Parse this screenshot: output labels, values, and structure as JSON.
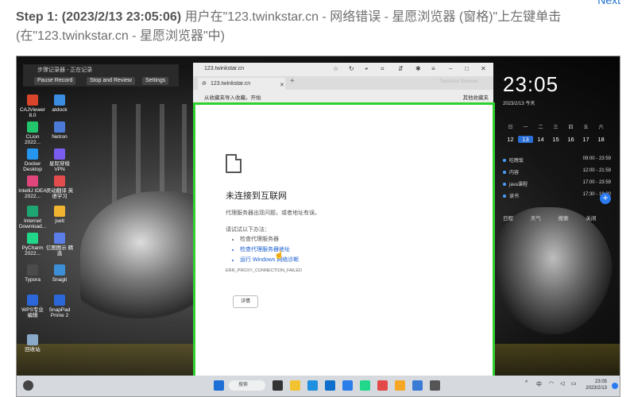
{
  "header": {
    "next_label": "Next",
    "step_label": "Step 1: (2023/2/13 23:05:06)",
    "step_desc": " 用户在\"123.twinkstar.cn - 网络错误  - 星愿浏览器 (窗格)\"上左键单击(在\"123.twinkstar.cn - 星愿浏览器\"中)"
  },
  "recorder": {
    "title": "步骤记录器 - 正在记录",
    "pause": "Pause Record",
    "stop": "Stop and Review",
    "settings": "Settings"
  },
  "desktop_icons": [
    {
      "label": "CAJViewer 8.0",
      "color": "#d9442b"
    },
    {
      "label": "atdock",
      "color": "#3a8de0"
    },
    {
      "label": "CLion 2022...",
      "color": "#22c56b"
    },
    {
      "label": "Netron",
      "color": "#4b7bd6"
    },
    {
      "label": "Docker Desktop",
      "color": "#2496ed"
    },
    {
      "label": "星际穿梭VPN",
      "color": "#7a5cf0"
    },
    {
      "label": "IntelliJ IDEA 2022...",
      "color": "#e0467c"
    },
    {
      "label": "灵动翻译 英语学习",
      "color": "#e24c4c"
    },
    {
      "label": "Internet Download...",
      "color": "#1ea672"
    },
    {
      "label": "jsetl",
      "color": "#f0b430"
    },
    {
      "label": "PyCharm 2022...",
      "color": "#21d789"
    },
    {
      "label": "亿图图示 精选",
      "color": "#5b7de8"
    },
    {
      "label": "Typora",
      "color": "#4b4b4b"
    },
    {
      "label": "Snagit",
      "color": "#3c8fd6"
    },
    {
      "label": "WPS专业 编辑",
      "color": "#2b67d8"
    },
    {
      "label": "SnapPad Prime 2",
      "color": "#2b67d8"
    },
    {
      "label": "回收站",
      "color": "#8aa8c8"
    }
  ],
  "browser": {
    "address": "123.twinkstar.cn",
    "tab_title": "123.twinkstar.cn",
    "tab_right": "Twinkstar Browser",
    "favorites_left": "从收藏夹导入收藏。开始",
    "favorites_right": "其他收藏夹"
  },
  "error_page": {
    "title": "未连接到互联网",
    "subtitle": "代理服务器出现问题，或者地址有误。",
    "try_label": "请试试以下办法：",
    "items": [
      "检查代理服务器",
      "检查代理服务器地址",
      "运行 Windows 网络诊断"
    ],
    "code": "ERR_PROXY_CONNECTION_FAILED",
    "details_button": "详情"
  },
  "widget": {
    "time": "23:05",
    "date": "2023/2/13  今天",
    "weekdays": [
      "日",
      "一",
      "二",
      "三",
      "四",
      "五",
      "六"
    ],
    "days": [
      "12",
      "13",
      "14",
      "15",
      "16",
      "17",
      "18"
    ],
    "selected_day": "13",
    "events": [
      {
        "label": "吃晚饭",
        "time": "09:00 - 23:59"
      },
      {
        "label": "内容",
        "time": "12:00 - 21:59"
      },
      {
        "label": "java课程",
        "time": "17:00 - 23:59"
      },
      {
        "label": "读书",
        "time": "17:30 - 18:30"
      }
    ],
    "footer": [
      "日程",
      "天气",
      "搜索",
      "关闭"
    ]
  },
  "taskbar": {
    "search_label": "搜索",
    "tray_text": "中",
    "time": "23:05",
    "date": "2023/2/13"
  }
}
